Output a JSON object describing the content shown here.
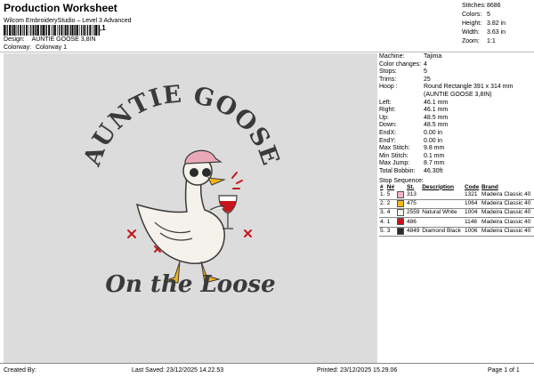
{
  "header": {
    "title": "Production Worksheet",
    "subtitle": "Wilcom EmbroideryStudio – Level 3 Advanced",
    "barcode_suffix": ",1",
    "design_label": "Design:",
    "design_value": "AUNTIE GOOSE 3,8IN",
    "colorway_label": "Colorway:",
    "colorway_value": "Colorway 1"
  },
  "stats": [
    {
      "k": "Stitches:",
      "v": "8686"
    },
    {
      "k": "Colors:",
      "v": "5"
    },
    {
      "k": "Height:",
      "v": "3.82 in"
    },
    {
      "k": "Width:",
      "v": "3.63 in"
    },
    {
      "k": "Zoom:",
      "v": "1:1"
    }
  ],
  "specs": [
    {
      "k": "Machine:",
      "v": "Tajima"
    },
    {
      "k": "Color changes:",
      "v": "4"
    },
    {
      "k": "Stops:",
      "v": "5"
    },
    {
      "k": "Trims:",
      "v": "25"
    },
    {
      "k": "Hoop :",
      "v": "Round Rectangle 391 x 314 mm"
    },
    {
      "k": "",
      "v": "(AUNTIE GOOSE 3,8IN)"
    },
    {
      "k": "Left:",
      "v": "46.1 mm"
    },
    {
      "k": "Right:",
      "v": "46.1 mm"
    },
    {
      "k": "Up:",
      "v": "48.5 mm"
    },
    {
      "k": "Down:",
      "v": "48.5 mm"
    },
    {
      "k": "EndX:",
      "v": "0.00 in"
    },
    {
      "k": "EndY:",
      "v": "0.00 in"
    },
    {
      "k": "Max Stitch:",
      "v": "9.8 mm"
    },
    {
      "k": "Min Stitch:",
      "v": "0.1 mm"
    },
    {
      "k": "Max Jump:",
      "v": "8.7 mm"
    },
    {
      "k": "Total Bobbin:",
      "v": "46.30ft"
    }
  ],
  "stop_sequence": {
    "title": "Stop Sequence:",
    "headers": [
      "#",
      "N#",
      "",
      "St.",
      "Description",
      "Code",
      "Brand"
    ],
    "rows": [
      {
        "idx": "1.",
        "n": "5",
        "color": "#f2b6c6",
        "st": "313",
        "desc": "",
        "code": "1321",
        "brand": "Madeira Classic 40"
      },
      {
        "idx": "2.",
        "n": "2",
        "color": "#f4b81c",
        "st": "475",
        "desc": "",
        "code": "1064",
        "brand": "Madeira Classic 40"
      },
      {
        "idx": "3.",
        "n": "4",
        "color": "#f5f3ea",
        "st": "2559",
        "desc": "Natural White",
        "code": "1004",
        "brand": "Madeira Classic 40"
      },
      {
        "idx": "4.",
        "n": "1",
        "color": "#c4161c",
        "st": "486",
        "desc": "",
        "code": "1146",
        "brand": "Madeira Classic 40"
      },
      {
        "idx": "5.",
        "n": "3",
        "color": "#2b2b2b",
        "st": "4849",
        "desc": "Diamond Black",
        "code": "1006",
        "brand": "Madeira Classic 40"
      }
    ]
  },
  "artwork": {
    "top_text": "AUNTIE GOOSE",
    "bottom_text": "On the Loose",
    "colors": {
      "text": "#3a3a3a",
      "goose": "#f4f2ea",
      "beak": "#f2b21c",
      "cap": "#e9a8b8",
      "wine": "#c4161c",
      "bg": "#dcdcdc"
    }
  },
  "footer": {
    "created_by": "Created By:",
    "last_saved": "Last Saved: 23/12/2025 14.22.53",
    "printed": "Printed: 23/12/2025 15.29.06",
    "page": "Page 1 of 1"
  }
}
